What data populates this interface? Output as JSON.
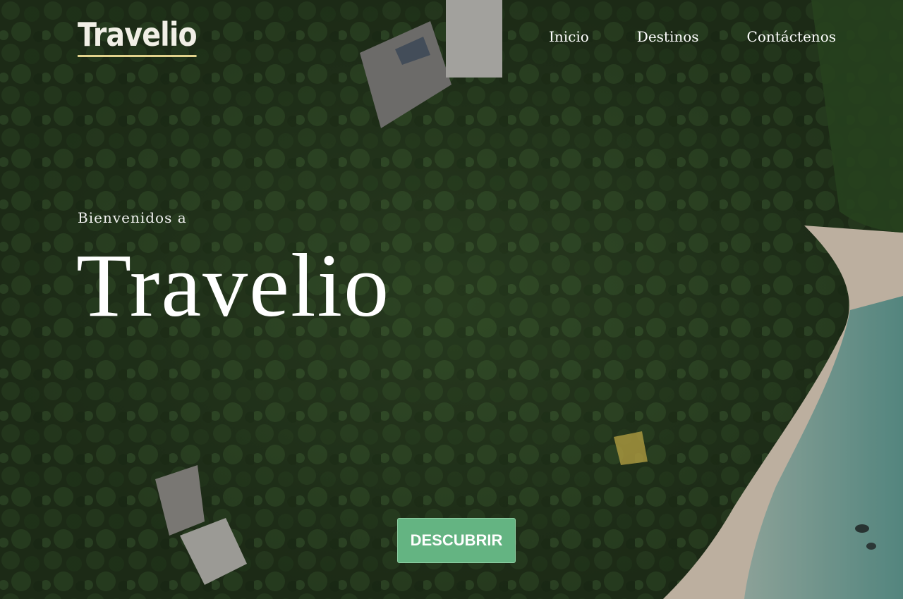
{
  "brand": {
    "logo": "Travelio"
  },
  "nav": {
    "items": [
      "Inicio",
      "Destinos",
      "Contáctenos"
    ]
  },
  "hero": {
    "welcome": "Bienvenidos a",
    "title": "Travelio",
    "cta_label": "DESCUBRIR"
  },
  "colors": {
    "accent": "#64b482",
    "logo_underline": "#e2d28c",
    "forest": "#1f2e1a",
    "sand": "#d9cdbb",
    "sea": "#6fa7a0"
  }
}
